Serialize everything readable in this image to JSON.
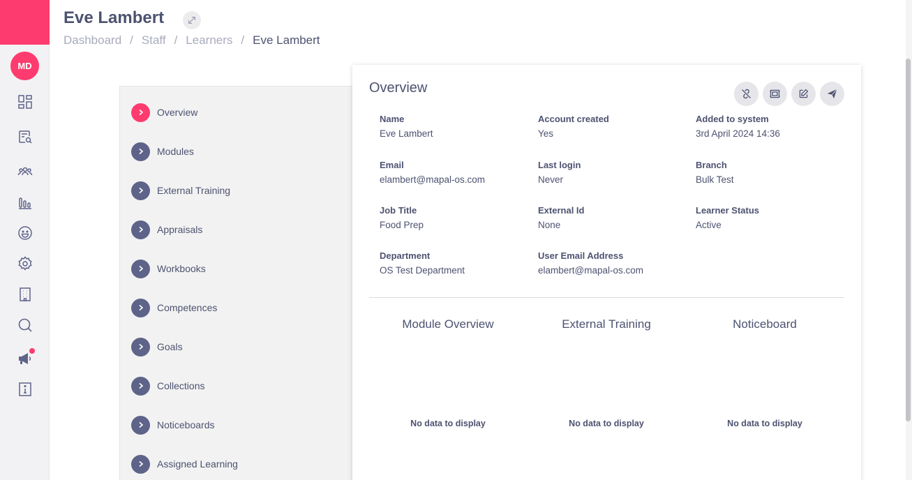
{
  "rail": {
    "user_initials": "MD",
    "icons": [
      "dashboard-icon",
      "content-search-icon",
      "people-icon",
      "reports-icon",
      "smiley-icon",
      "settings-icon",
      "building-icon",
      "search-icon",
      "megaphone-icon",
      "info-icon"
    ]
  },
  "header": {
    "title": "Eve Lambert",
    "breadcrumb": [
      "Dashboard",
      "Staff",
      "Learners",
      "Eve Lambert"
    ],
    "separator": "/"
  },
  "menu": {
    "items": [
      "Overview",
      "Modules",
      "External Training",
      "Appraisals",
      "Workbooks",
      "Competences",
      "Goals",
      "Collections",
      "Noticeboards",
      "Assigned Learning"
    ],
    "active": "Overview"
  },
  "overview": {
    "title": "Overview",
    "fields": [
      {
        "key": "Name",
        "value": "Eve Lambert"
      },
      {
        "key": "Account created",
        "value": "Yes"
      },
      {
        "key": "Added to system",
        "value": "3rd April 2024 14:36"
      },
      {
        "key": "Email",
        "value": "elambert@mapal-os.com"
      },
      {
        "key": "Last login",
        "value": "Never"
      },
      {
        "key": "Branch",
        "value": "Bulk Test"
      },
      {
        "key": "Job Title",
        "value": "Food Prep"
      },
      {
        "key": "External Id",
        "value": "None"
      },
      {
        "key": "Learner Status",
        "value": "Active"
      },
      {
        "key": "Department",
        "value": "OS Test Department"
      },
      {
        "key": "User Email Address",
        "value": "elambert@mapal-os.com"
      }
    ],
    "widgets": [
      {
        "title": "Module Overview",
        "empty": "No data to display"
      },
      {
        "title": "External Training",
        "empty": "No data to display"
      },
      {
        "title": "Noticeboard",
        "empty": "No data to display"
      }
    ]
  },
  "colors": {
    "accent": "#fe3b6e",
    "chevron": "#5e6389",
    "text": "#4d5270"
  }
}
